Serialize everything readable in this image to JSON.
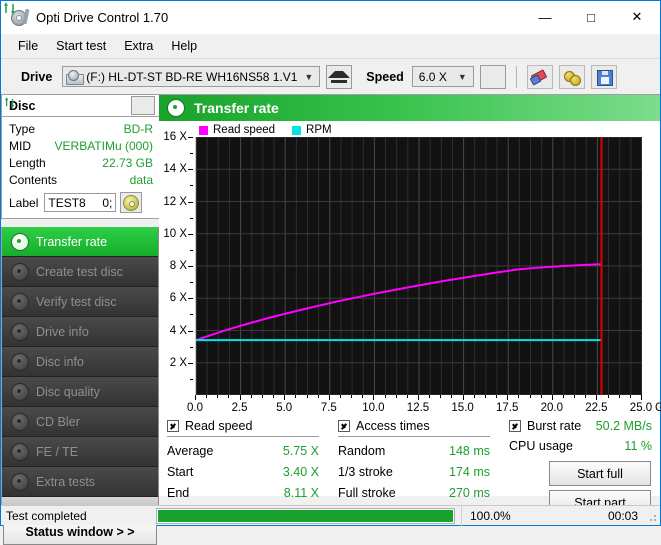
{
  "window": {
    "title": "Opti Drive Control 1.70",
    "icon": "optical-disc-icon",
    "minimize": "—",
    "maximize": "□",
    "close": "✕"
  },
  "menubar": {
    "items": [
      "File",
      "Start test",
      "Extra",
      "Help"
    ]
  },
  "toolbar": {
    "drive_label": "Drive",
    "drive_value": "(F:)  HL-DT-ST BD-RE  WH16NS58 1.V1",
    "eject_icon": "eject-icon",
    "speed_label": "Speed",
    "speed_value": "6.0 X",
    "refresh_icon": "refresh-icon",
    "eraser_icon": "eraser-icon",
    "gold_icon": "chain-link-icon",
    "save_icon": "save-floppy-icon"
  },
  "disc": {
    "header": "Disc",
    "refresh_icon": "refresh-icon",
    "rows": [
      {
        "key": "Type",
        "value": "BD-R"
      },
      {
        "key": "MID",
        "value": "VERBATIMu (000)"
      },
      {
        "key": "Length",
        "value": "22.73 GB"
      },
      {
        "key": "Contents",
        "value": "data"
      }
    ],
    "label_key": "Label",
    "label_value": "TEST8",
    "label_value2": "0;",
    "disc_button_icon": "disc-icon"
  },
  "nav": {
    "items": [
      {
        "label": "Transfer rate",
        "active": true
      },
      {
        "label": "Create test disc",
        "active": false
      },
      {
        "label": "Verify test disc",
        "active": false
      },
      {
        "label": "Drive info",
        "active": false
      },
      {
        "label": "Disc info",
        "active": false
      },
      {
        "label": "Disc quality",
        "active": false
      },
      {
        "label": "CD Bler",
        "active": false
      },
      {
        "label": "FE / TE",
        "active": false
      },
      {
        "label": "Extra tests",
        "active": false
      }
    ],
    "status_window": "Status window > >"
  },
  "chart_panel": {
    "title": "Transfer rate",
    "title_icon": "disc-icon"
  },
  "chart_data": {
    "type": "line",
    "title": "Transfer rate",
    "xlabel": "GB",
    "ylabel": "X",
    "xlim": [
      0.0,
      25.0
    ],
    "ylim": [
      0,
      16
    ],
    "xticks": [
      "0.0",
      "2.5",
      "5.0",
      "7.5",
      "10.0",
      "12.5",
      "15.0",
      "17.5",
      "20.0",
      "22.5",
      "25.0"
    ],
    "xtick_values": [
      0,
      2.5,
      5,
      7.5,
      10,
      12.5,
      15,
      17.5,
      20,
      22.5,
      25
    ],
    "x_unit": "GB",
    "yticks": [
      "2 X",
      "4 X",
      "6 X",
      "8 X",
      "10 X",
      "12 X",
      "14 X",
      "16 X"
    ],
    "ytick_values": [
      2,
      4,
      6,
      8,
      10,
      12,
      14,
      16
    ],
    "grid": true,
    "legend_position": "top-left",
    "plot_bg": "#121212",
    "marker_line": {
      "x": 22.73,
      "color": "#e00000"
    },
    "series": [
      {
        "name": "Read speed",
        "color": "#ff00ff",
        "x": [
          0.0,
          1.0,
          2.0,
          3.0,
          4.0,
          5.0,
          6.0,
          7.0,
          8.0,
          9.0,
          10.0,
          11.0,
          12.0,
          13.0,
          14.0,
          15.0,
          16.0,
          17.0,
          18.0,
          19.0,
          20.0,
          21.0,
          22.0,
          22.73
        ],
        "values": [
          3.4,
          3.78,
          4.13,
          4.45,
          4.76,
          5.04,
          5.31,
          5.57,
          5.82,
          6.05,
          6.28,
          6.49,
          6.7,
          6.9,
          7.09,
          7.27,
          7.45,
          7.62,
          7.78,
          7.88,
          7.96,
          8.02,
          8.08,
          8.11
        ]
      },
      {
        "name": "RPM",
        "color": "#00e5e5",
        "x": [
          0.0,
          2.0,
          4.0,
          6.0,
          8.0,
          10.0,
          12.0,
          14.0,
          16.0,
          18.0,
          20.0,
          22.0,
          22.73
        ],
        "values": [
          3.4,
          3.4,
          3.4,
          3.4,
          3.4,
          3.4,
          3.4,
          3.4,
          3.4,
          3.4,
          3.4,
          3.4,
          3.4
        ]
      }
    ]
  },
  "results": {
    "read_speed": {
      "header": "Read speed",
      "checked": true,
      "rows": [
        {
          "key": "Average",
          "value": "5.75 X"
        },
        {
          "key": "Start",
          "value": "3.40 X"
        },
        {
          "key": "End",
          "value": "8.11 X"
        }
      ]
    },
    "access_times": {
      "header": "Access times",
      "checked": true,
      "rows": [
        {
          "key": "Random",
          "value": "148 ms"
        },
        {
          "key": "1/3 stroke",
          "value": "174 ms"
        },
        {
          "key": "Full stroke",
          "value": "270 ms"
        }
      ]
    },
    "burst": {
      "header": "Burst rate",
      "checked": true,
      "value": "50.2 MB/s",
      "cpu_key": "CPU usage",
      "cpu_value": "11 %"
    },
    "start_full": "Start full",
    "start_part": "Start part"
  },
  "statusbar": {
    "text": "Test completed",
    "percent": "100.0%",
    "progress": 100,
    "time": "00:03"
  }
}
